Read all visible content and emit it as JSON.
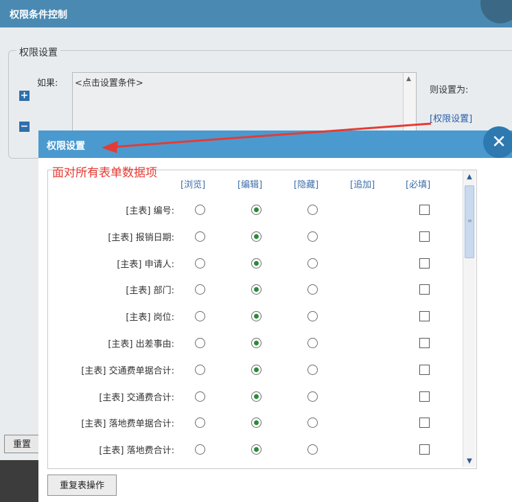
{
  "outer_window": {
    "title": "权限条件控制",
    "legend": "权限设置",
    "if_label": "如果:",
    "condition_text": "<点击设置条件>",
    "then_label": "则设置为:",
    "permission_link": "[权限设置]",
    "reset_label": "重置"
  },
  "dialog": {
    "title": "权限设置",
    "close_label": "✕",
    "annotation": "面对所有表单数据项",
    "columns": [
      "[浏览]",
      "[编辑]",
      "[隐藏]",
      "[追加]",
      "[必填]"
    ],
    "rows": [
      {
        "label": "[主表] 编号:",
        "selected": "edit",
        "required": false
      },
      {
        "label": "[主表] 报销日期:",
        "selected": "edit",
        "required": false
      },
      {
        "label": "[主表] 申请人:",
        "selected": "edit",
        "required": false
      },
      {
        "label": "[主表] 部门:",
        "selected": "edit",
        "required": false
      },
      {
        "label": "[主表] 岗位:",
        "selected": "edit",
        "required": false
      },
      {
        "label": "[主表] 出差事由:",
        "selected": "edit",
        "required": false
      },
      {
        "label": "[主表] 交通费单据合计:",
        "selected": "edit",
        "required": false
      },
      {
        "label": "[主表] 交通费合计:",
        "selected": "edit",
        "required": false
      },
      {
        "label": "[主表] 落地费单据合计:",
        "selected": "edit",
        "required": false
      },
      {
        "label": "[主表] 落地费合计:",
        "selected": "edit",
        "required": false
      }
    ],
    "repeat_button": "重复表操作"
  },
  "colors": {
    "title_blue": "#4a9ad0",
    "link_blue": "#2b5fa8",
    "annotation_red": "#e53b34",
    "selected_green": "#2a8a3a"
  }
}
